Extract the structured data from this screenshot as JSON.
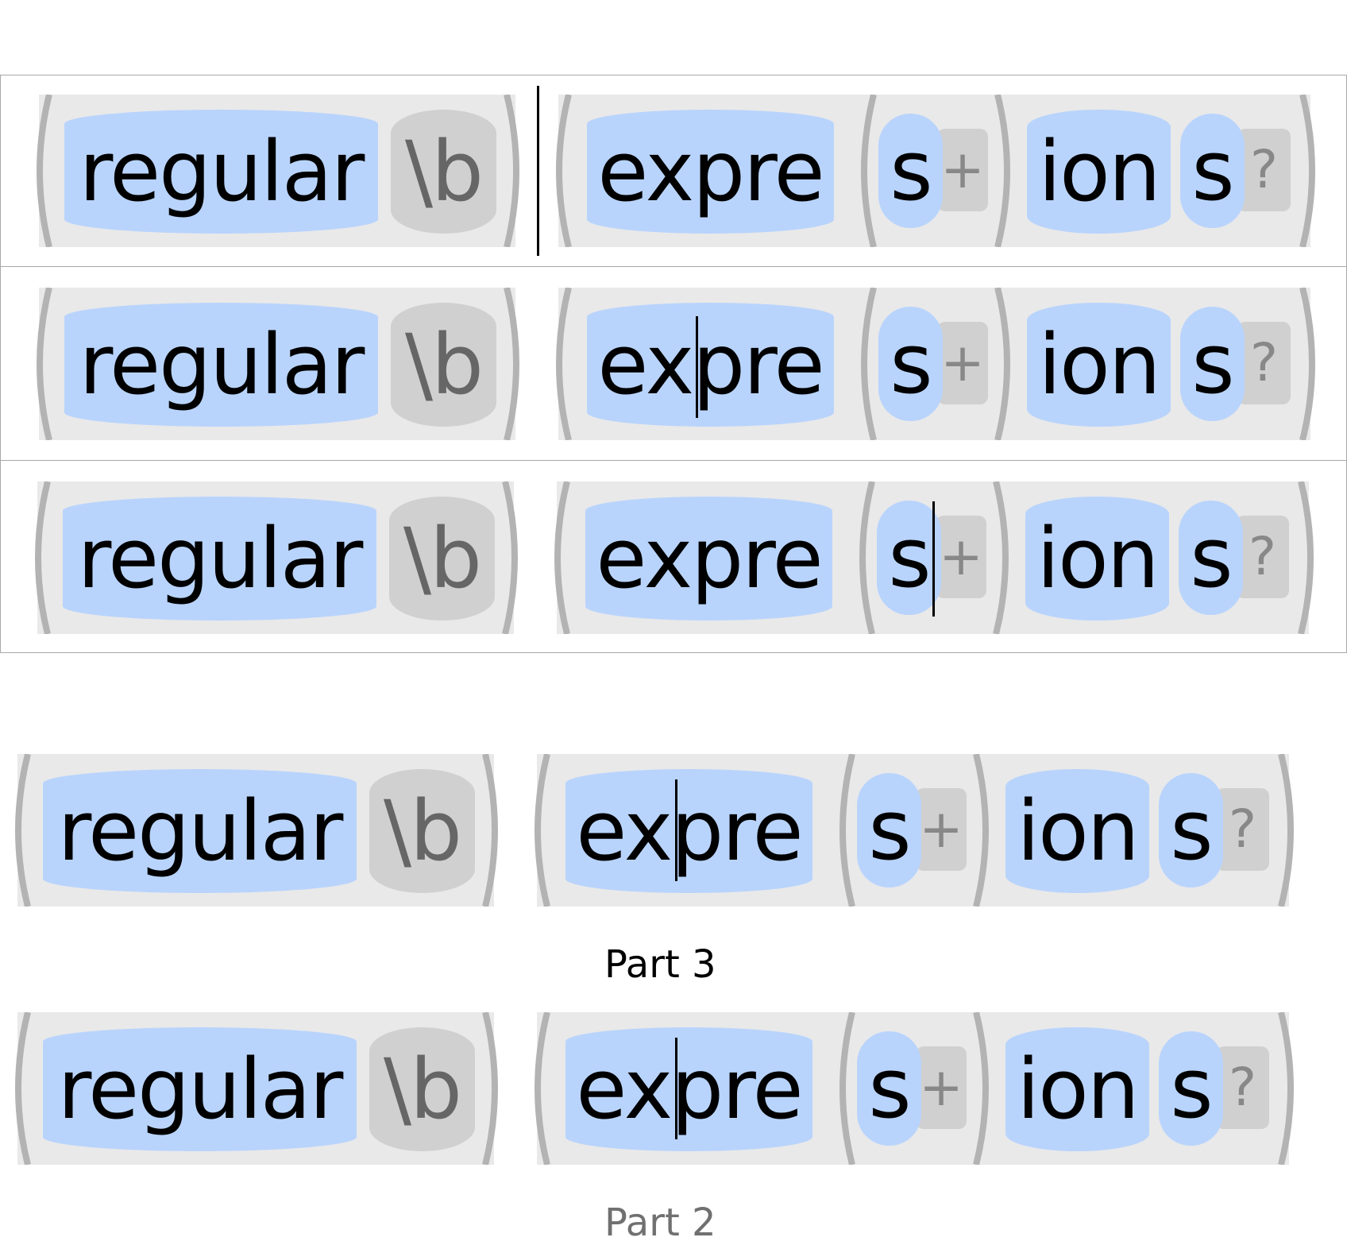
{
  "tokens": {
    "word1": "regular",
    "boundary": "\\b",
    "word2": "expre",
    "repeat_char": "s",
    "plus_quantifier": "+",
    "word3": "ion",
    "optional_char": "s",
    "optional_quantifier": "?"
  },
  "rows": [
    {
      "caret": "between-groups"
    },
    {
      "caret": "inside-expre-after-ex"
    },
    {
      "caret": "after-s-before-plus"
    },
    {
      "caret": "inside-expre-after-ex"
    },
    {
      "caret": "inside-expre-after-ex"
    }
  ],
  "labels": {
    "part3": "Part 3",
    "part2": "Part 2"
  },
  "colors": {
    "literal_bg": "#b9d4fc",
    "escape_bg": "#d0d0d0",
    "group_bg": "#e9e9e9",
    "paren": "#b3b3b3",
    "label_active": "#000000",
    "label_inactive": "#707070"
  }
}
